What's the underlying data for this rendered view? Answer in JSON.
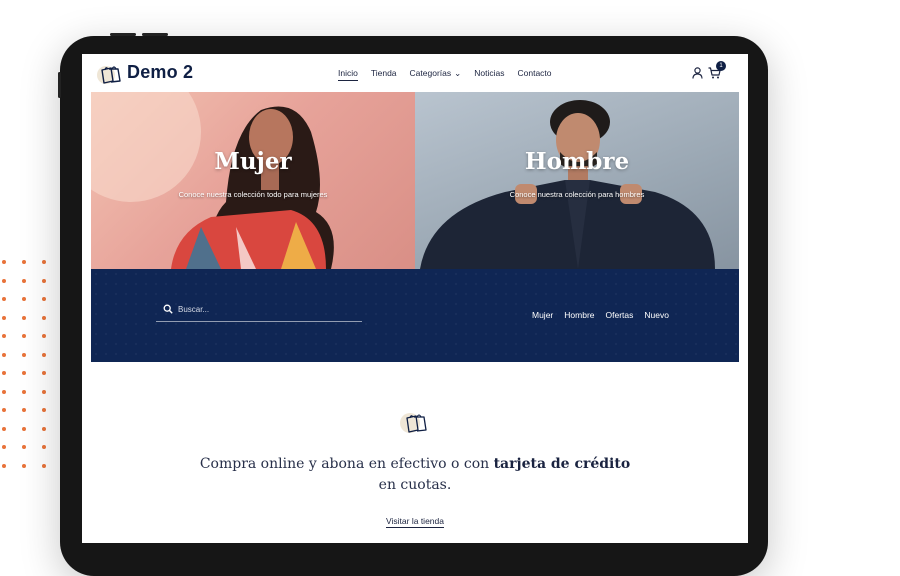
{
  "header": {
    "logo_text": "Demo 2",
    "nav": {
      "inicio": "Inicio",
      "tienda": "Tienda",
      "categorias": "Categorías",
      "noticias": "Noticias",
      "contacto": "Contacto"
    },
    "cart_count": "1"
  },
  "hero": {
    "women": {
      "title": "Mujer",
      "subtitle": "Conoce nuestra colección todo para mujeres"
    },
    "men": {
      "title": "Hombre",
      "subtitle": "Conoce nuestra colección para hombres"
    }
  },
  "search": {
    "placeholder": "Buscar..."
  },
  "quick_links": {
    "mujer": "Mujer",
    "hombre": "Hombre",
    "ofertas": "Ofertas",
    "nuevo": "Nuevo"
  },
  "promo": {
    "text_before": "Compra online y abona en efectivo o con ",
    "text_bold": "tarjeta de crédito",
    "text_after": " en cuotas.",
    "link": "Visitar la tienda"
  },
  "colors": {
    "navy": "#0f2654",
    "accent_dots": "#e8733a"
  }
}
